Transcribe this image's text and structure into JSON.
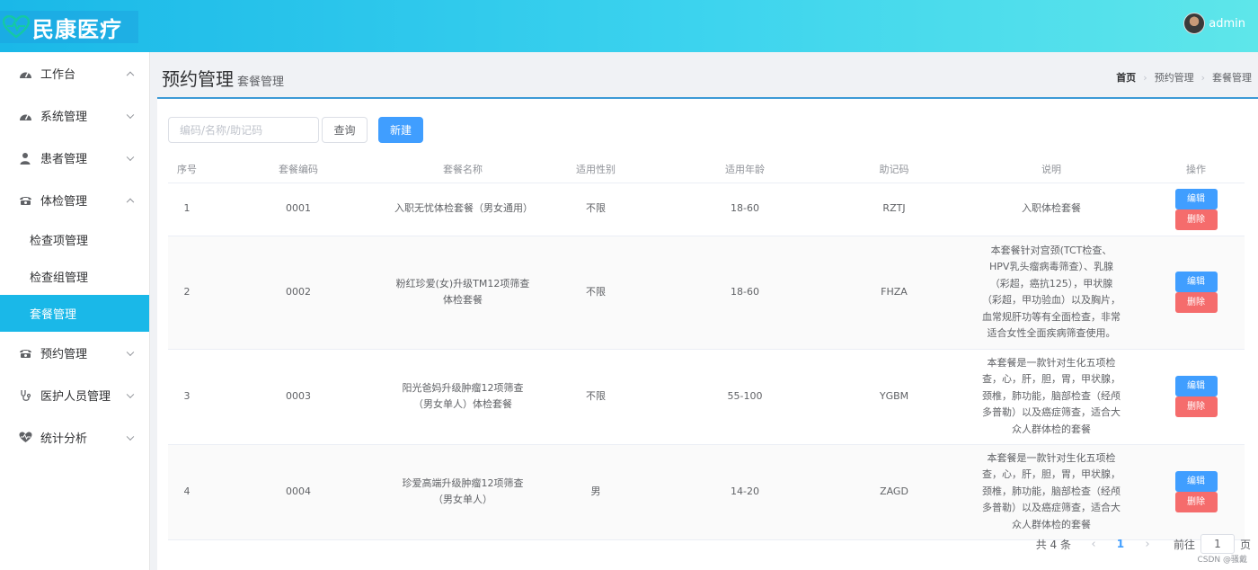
{
  "header": {
    "logo_text": "民康医疗",
    "username": "admin"
  },
  "sidebar": {
    "items": [
      {
        "label": "工作台",
        "icon": "dashboard-icon",
        "expanded": true
      },
      {
        "label": "系统管理",
        "icon": "dashboard-icon",
        "expanded": false
      },
      {
        "label": "患者管理",
        "icon": "user-icon",
        "expanded": false
      },
      {
        "label": "体检管理",
        "icon": "phone-icon",
        "expanded": true
      },
      {
        "label": "预约管理",
        "icon": "phone-icon",
        "expanded": false
      },
      {
        "label": "医护人员管理",
        "icon": "stethoscope-icon",
        "expanded": false
      },
      {
        "label": "统计分析",
        "icon": "heart-pulse-icon",
        "expanded": false
      }
    ],
    "sub_items": [
      {
        "label": "检查项管理"
      },
      {
        "label": "检查组管理"
      },
      {
        "label": "套餐管理",
        "active": true
      }
    ]
  },
  "page": {
    "title": "预约管理",
    "subtitle": "套餐管理",
    "breadcrumb": [
      "首页",
      "预约管理",
      "套餐管理"
    ]
  },
  "toolbar": {
    "search_placeholder": "编码/名称/助记码",
    "search_value": "",
    "query_label": "查询",
    "new_label": "新建"
  },
  "table": {
    "columns": [
      "序号",
      "套餐编码",
      "套餐名称",
      "适用性别",
      "适用年龄",
      "助记码",
      "说明",
      "操作"
    ],
    "edit_label": "编辑",
    "delete_label": "删除",
    "rows": [
      {
        "index": "1",
        "code": "0001",
        "name": "入职无忧体检套餐（男女通用）",
        "gender": "不限",
        "age": "18-60",
        "mnemonic": "RZTJ",
        "desc": "入职体检套餐"
      },
      {
        "index": "2",
        "code": "0002",
        "name": "粉红珍爱(女)升级TM12项筛查体检套餐",
        "gender": "不限",
        "age": "18-60",
        "mnemonic": "FHZA",
        "desc": "本套餐针对宫颈(TCT检查、HPV乳头瘤病毒筛查）、乳腺（彩超，癌抗125），甲状腺（彩超，甲功验血）以及胸片，血常规肝功等有全面检查，非常适合女性全面疾病筛查使用。"
      },
      {
        "index": "3",
        "code": "0003",
        "name": "阳光爸妈升级肿瘤12项筛查（男女单人）体检套餐",
        "gender": "不限",
        "age": "55-100",
        "mnemonic": "YGBM",
        "desc": "本套餐是一款针对生化五项检查，心，肝，胆，胃，甲状腺，颈椎，肺功能，脑部检查（经颅多普勒）以及癌症筛查，适合大众人群体检的套餐"
      },
      {
        "index": "4",
        "code": "0004",
        "name": "珍爱高端升级肿瘤12项筛查（男女单人）",
        "gender": "男",
        "age": "14-20",
        "mnemonic": "ZAGD",
        "desc": "本套餐是一款针对生化五项检查，心，肝，胆，胃，甲状腺，颈椎，肺功能，脑部检查（经颅多普勒）以及癌症筛查，适合大众人群体检的套餐"
      }
    ]
  },
  "pagination": {
    "total_text": "共 4 条",
    "current_page": "1",
    "goto_label": "前往",
    "goto_value": "1",
    "page_suffix": "页"
  },
  "watermark": "CSDN @骚戴",
  "colors": {
    "header_start": "#1ab8e8",
    "header_end": "#5ee6ea",
    "active_menu": "#1ab8e8",
    "primary": "#409eff",
    "danger": "#f56c6c"
  }
}
